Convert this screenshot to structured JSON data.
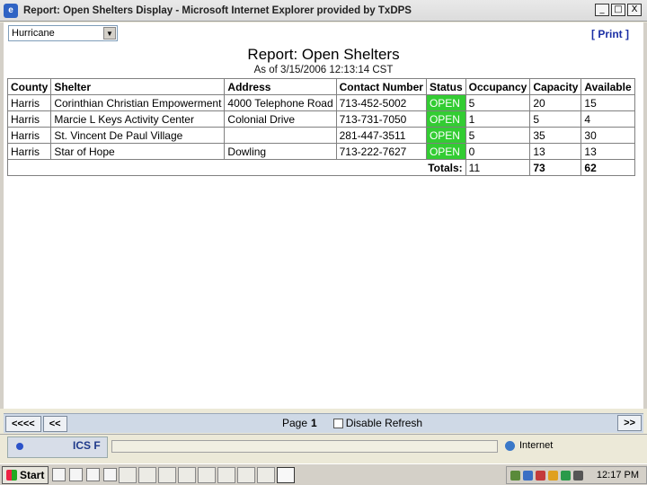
{
  "window": {
    "title": "Report: Open Shelters Display - Microsoft Internet Explorer provided by TxDPS",
    "app_icon": "e",
    "buttons": {
      "minimize": "_",
      "maximize": "□",
      "close": "X"
    }
  },
  "toolbar": {
    "filter_selected": "Hurricane",
    "print_label": "[ Print ]"
  },
  "report": {
    "title": "Report: Open Shelters",
    "as_of": "As of 3/15/2006 12:13:14 CST",
    "columns": [
      "County",
      "Shelter",
      "Address",
      "Contact Number",
      "Status",
      "Occupancy",
      "Capacity",
      "Available"
    ],
    "rows": [
      [
        "Harris",
        "Corinthian Christian Empowerment",
        "4000 Telephone Road",
        "713-452-5002",
        "OPEN",
        "5",
        "20",
        "15"
      ],
      [
        "Harris",
        "Marcie L Keys Activity Center",
        "Colonial Drive",
        "713-731-7050",
        "OPEN",
        "1",
        "5",
        "4"
      ],
      [
        "Harris",
        "St. Vincent De Paul Village",
        "",
        "281-447-3511",
        "OPEN",
        "5",
        "35",
        "30"
      ],
      [
        "Harris",
        "Star of Hope",
        "Dowling",
        "713-222-7627",
        "OPEN",
        "0",
        "13",
        "13"
      ]
    ],
    "totals": {
      "label": "Totals:",
      "occupancy": "11",
      "capacity": "73",
      "available": "62"
    }
  },
  "pager": {
    "first": "<<<<",
    "prev": "<<",
    "page_label": "Page",
    "page_number": "1",
    "refresh_label": "Disable Refresh",
    "next": ">>"
  },
  "statusbar": {
    "ics_label": "ICS F",
    "zone": "Internet"
  },
  "taskbar": {
    "start": "Start",
    "clock": "12:17 PM"
  },
  "colors": {
    "status_open": "#33cc33",
    "link": "#1b2fa5"
  }
}
